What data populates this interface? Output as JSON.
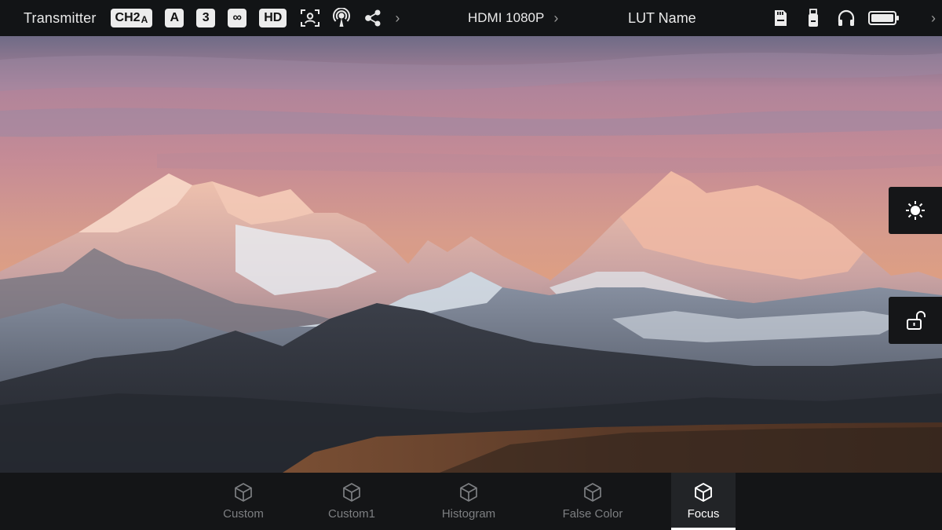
{
  "topbar": {
    "title": "Transmitter",
    "channel_main": "CH2",
    "channel_sub": "A",
    "badge_a": "A",
    "badge_num": "3",
    "badge_loop": "∞",
    "badge_hd": "HD",
    "input_signal": "HDMI 1080P",
    "lut_name": "LUT Name",
    "chevron": "›",
    "icons": [
      "face-detect-icon",
      "broadcast-icon",
      "share-node-icon",
      "sd-card-icon",
      "usb-drive-icon",
      "headphones-icon",
      "battery-icon"
    ]
  },
  "side_buttons": [
    "brightness-icon",
    "unlock-icon"
  ],
  "tabs": [
    {
      "label": "Custom",
      "active": false
    },
    {
      "label": "Custom1",
      "active": false
    },
    {
      "label": "Histogram",
      "active": false
    },
    {
      "label": "False Color",
      "active": false
    },
    {
      "label": "Focus",
      "active": true
    }
  ],
  "colors": {
    "bar_bg": "#121416",
    "tab_active_bg": "#222427",
    "tab_inactive_text": "#7d7f82",
    "badge_bg": "#ececec"
  }
}
